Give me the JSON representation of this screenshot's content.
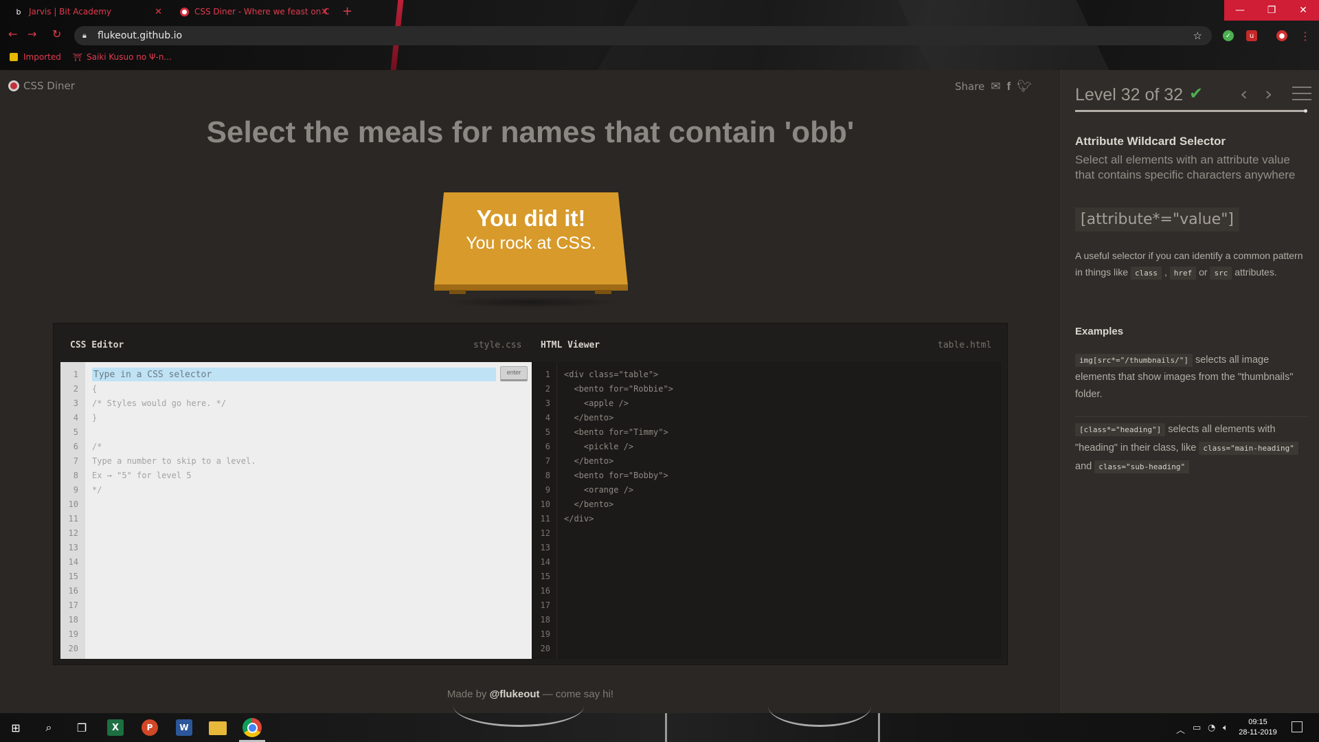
{
  "browser": {
    "tabs": [
      {
        "favicon": "b",
        "title": "Jarvis | Bit Academy"
      },
      {
        "favicon": "",
        "title": "CSS Diner - Where we feast on C"
      }
    ],
    "new_tab": "+",
    "url": "flukeout.github.io",
    "bookmarks": [
      {
        "label": "Imported"
      },
      {
        "label": "Saiki Kusuo no Ψ-n..."
      }
    ],
    "window_controls": {
      "minimize": "—",
      "maximize": "❐",
      "close": "✕"
    },
    "nav": {
      "back": "←",
      "forward": "→",
      "reload": "↻"
    }
  },
  "site": {
    "logo": "CSS Diner",
    "share_label": "Share",
    "share_icons": [
      "mail-icon",
      "facebook-icon",
      "twitter-icon"
    ]
  },
  "level": {
    "instruction": "Select the meals for names that contain 'obb'",
    "win_line1": "You did it!",
    "win_line2": "You rock at CSS."
  },
  "editor": {
    "css_title": "CSS Editor",
    "css_file": "style.css",
    "input_placeholder": "Type in a CSS selector",
    "enter_label": "enter",
    "css_lines": [
      "{",
      "/* Styles would go here. */",
      "}",
      "",
      "/*",
      "Type a number to skip to a level.",
      "Ex → \"5\" for level 5",
      "*/"
    ],
    "html_title": "HTML Viewer",
    "html_file": "table.html",
    "html_lines": [
      "<div class=\"table\">",
      "  <bento for=\"Robbie\">",
      "    <apple />",
      "  </bento>",
      "  <bento for=\"Timmy\">",
      "    <pickle />",
      "  </bento>",
      "  <bento for=\"Bobby\">",
      "    <orange />",
      "  </bento>",
      "</div>"
    ],
    "line_count": 20
  },
  "footer": {
    "prefix": "Made by ",
    "author": "@flukeout",
    "suffix": " — come say hi!"
  },
  "sidebar": {
    "level_label": "Level 32 of 32",
    "progress": 1.0,
    "selector_name": "Attribute Wildcard Selector",
    "selector_desc": "Select all elements with an attribute value that contains specific characters anywhere",
    "syntax": "[attribute*=\"value\"]",
    "hint_prefix": "A useful selector if you can identify a common pattern in things like ",
    "hint_code1": "class",
    "hint_sep1": " , ",
    "hint_code2": "href",
    "hint_sep2": " or ",
    "hint_code3": "src",
    "hint_suffix": " attributes.",
    "examples_title": "Examples",
    "ex1_code": "img[src*=\"/thumbnails/\"]",
    "ex1_text": " selects all image elements that show images from the \"thumbnails\" folder.",
    "ex2_code": "[class*=\"heading\"]",
    "ex2_text": " selects all elements with \"heading\" in their class, like ",
    "ex2_code2": "class=\"main-heading\"",
    "ex2_mid": " and ",
    "ex2_code3": "class=\"sub-heading\""
  },
  "taskbar": {
    "time": "09:15",
    "date": "28-11-2019",
    "apps": [
      "start-icon",
      "search-icon",
      "task-view-icon",
      "excel-icon",
      "powerpoint-icon",
      "word-icon",
      "file-explorer-icon",
      "chrome-icon"
    ]
  }
}
